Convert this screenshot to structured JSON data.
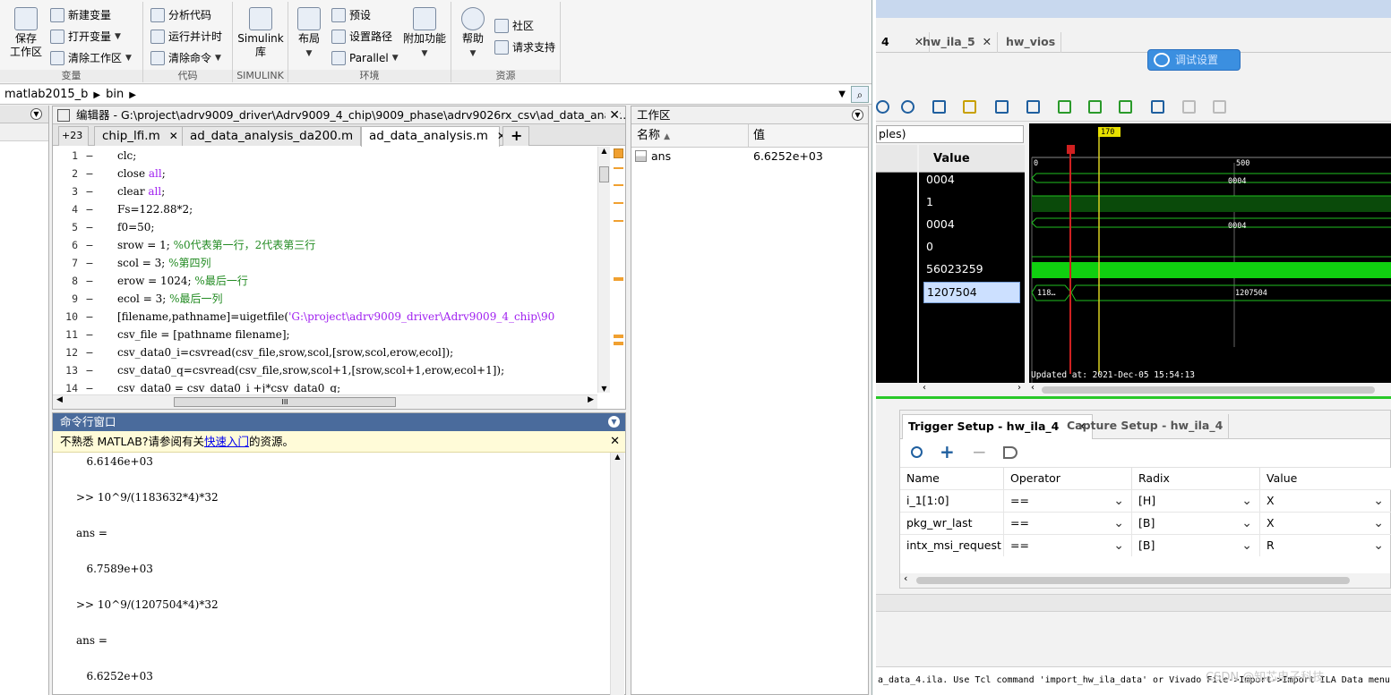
{
  "ribbon": {
    "groups": [
      {
        "name": "变量",
        "big": "保存\n工作区",
        "items": [
          "新建变量",
          "打开变量",
          "清除工作区"
        ]
      },
      {
        "name": "代码",
        "items": [
          "分析代码",
          "运行并计时",
          "清除命令"
        ]
      },
      {
        "name": "SIMULINK",
        "big": "Simulink\n库"
      },
      {
        "name": "环境",
        "big1": "布局",
        "items": [
          "预设",
          "设置路径",
          "Parallel"
        ]
      },
      {
        "name": "",
        "big": "附加功能"
      },
      {
        "name": "资源",
        "big": "帮助",
        "items": [
          "社区",
          "请求支持"
        ]
      }
    ]
  },
  "address": {
    "path1": "matlab2015_b",
    "path2": "bin"
  },
  "editor": {
    "title": "编辑器 - G:\\project\\adrv9009_driver\\Adrv9009_4_chip\\9009_phase\\adrv9026rx_csv\\ad_data_analy...",
    "overflow": "+23",
    "tabs": [
      "chip_lfi.m",
      "ad_data_analysis_da200.m",
      "ad_data_analysis.m"
    ],
    "add_tab": "+",
    "lines": [
      {
        "n": "1",
        "parts": [
          [
            "clc;",
            ""
          ]
        ]
      },
      {
        "n": "2",
        "parts": [
          [
            "close ",
            ""
          ],
          [
            "all",
            "kw"
          ],
          [
            ";",
            ""
          ]
        ]
      },
      {
        "n": "3",
        "parts": [
          [
            "clear ",
            ""
          ],
          [
            "all",
            "kw"
          ],
          [
            ";",
            ""
          ]
        ]
      },
      {
        "n": "4",
        "parts": [
          [
            "Fs=122.88*2;",
            ""
          ]
        ]
      },
      {
        "n": "5",
        "parts": [
          [
            "f0=50;",
            ""
          ]
        ]
      },
      {
        "n": "6",
        "parts": [
          [
            "srow = 1;  ",
            ""
          ],
          [
            "%0代表第一行，2代表第三行",
            "cm"
          ]
        ]
      },
      {
        "n": "7",
        "parts": [
          [
            "scol = 3;  ",
            ""
          ],
          [
            "%第四列",
            "cm"
          ]
        ]
      },
      {
        "n": "8",
        "parts": [
          [
            "erow = 1024; ",
            ""
          ],
          [
            "%最后一行",
            "cm"
          ]
        ]
      },
      {
        "n": "9",
        "parts": [
          [
            "ecol = 3;    ",
            ""
          ],
          [
            "%最后一列",
            "cm"
          ]
        ]
      },
      {
        "n": "10",
        "parts": [
          [
            "[filename,pathname]=uigetfile(",
            ""
          ],
          [
            "'G:\\project\\adrv9009_driver\\Adrv9009_4_chip\\90",
            "str"
          ]
        ]
      },
      {
        "n": "11",
        "parts": [
          [
            "csv_file = [pathname filename];",
            ""
          ]
        ]
      },
      {
        "n": "12",
        "parts": [
          [
            "csv_data0_i=csvread(csv_file,srow,scol,[srow,scol,erow,ecol]);",
            ""
          ]
        ]
      },
      {
        "n": "13",
        "parts": [
          [
            "csv_data0_q=csvread(csv_file,srow,scol+1,[srow,scol+1,erow,ecol+1]);",
            ""
          ]
        ]
      },
      {
        "n": "14",
        "parts": [
          [
            "csv_data0  = csv_data0_i  +j*csv_data0_q;",
            ""
          ]
        ]
      }
    ],
    "hscroll_grip": "III"
  },
  "workspace": {
    "title": "工作区",
    "col_name": "名称",
    "col_value": "值",
    "rows": [
      {
        "name": "ans",
        "value": "6.6252e+03"
      }
    ]
  },
  "command": {
    "title": "命令行窗口",
    "tip_pre": "不熟悉 MATLAB?请参阅有关",
    "tip_link": "快速入门",
    "tip_post": "的资源。",
    "lines": [
      "   6.6146e+03",
      "",
      ">> 10^9/(1183632*4)*32",
      "",
      "ans =",
      "",
      "   6.7589e+03",
      "",
      ">> 10^9/(1207504*4)*32",
      "",
      "ans =",
      "",
      "   6.6252e+03"
    ]
  },
  "vivado": {
    "tabs": [
      "4",
      "hw_ila_5",
      "hw_vios"
    ],
    "blue_button": "调试设置",
    "search": "ples)",
    "value_header": "Value",
    "values": [
      "0004",
      "1",
      "0004",
      "0",
      "56023259",
      "1207504"
    ],
    "selected_value": "1207504",
    "wave": {
      "marker": "170",
      "tick0": "0",
      "tick500": "500",
      "bus1": "0004",
      "bus3": "0004",
      "bus6_left": "118…",
      "bus6": "1207504",
      "updated": "Updated at: 2021-Dec-05 15:54:13"
    },
    "trigger": {
      "tab_active": "Trigger Setup - hw_ila_4",
      "tab_other": "Capture Setup - hw_ila_4",
      "headers": [
        "Name",
        "Operator",
        "Radix",
        "Value"
      ],
      "rows": [
        {
          "name": "i_1[1:0]",
          "op": "==",
          "radix": "[H]",
          "value": "X"
        },
        {
          "name": "pkg_wr_last",
          "op": "==",
          "radix": "[B]",
          "value": "X"
        },
        {
          "name": "intx_msi_request",
          "op": "==",
          "radix": "[B]",
          "value": "R"
        }
      ]
    },
    "log": "a_data_4.ila. Use Tcl command 'import_hw_ila_data' or Vivado File->Import->Import ILA Data menu",
    "watermark": "CSDN @知芯电子科技"
  }
}
